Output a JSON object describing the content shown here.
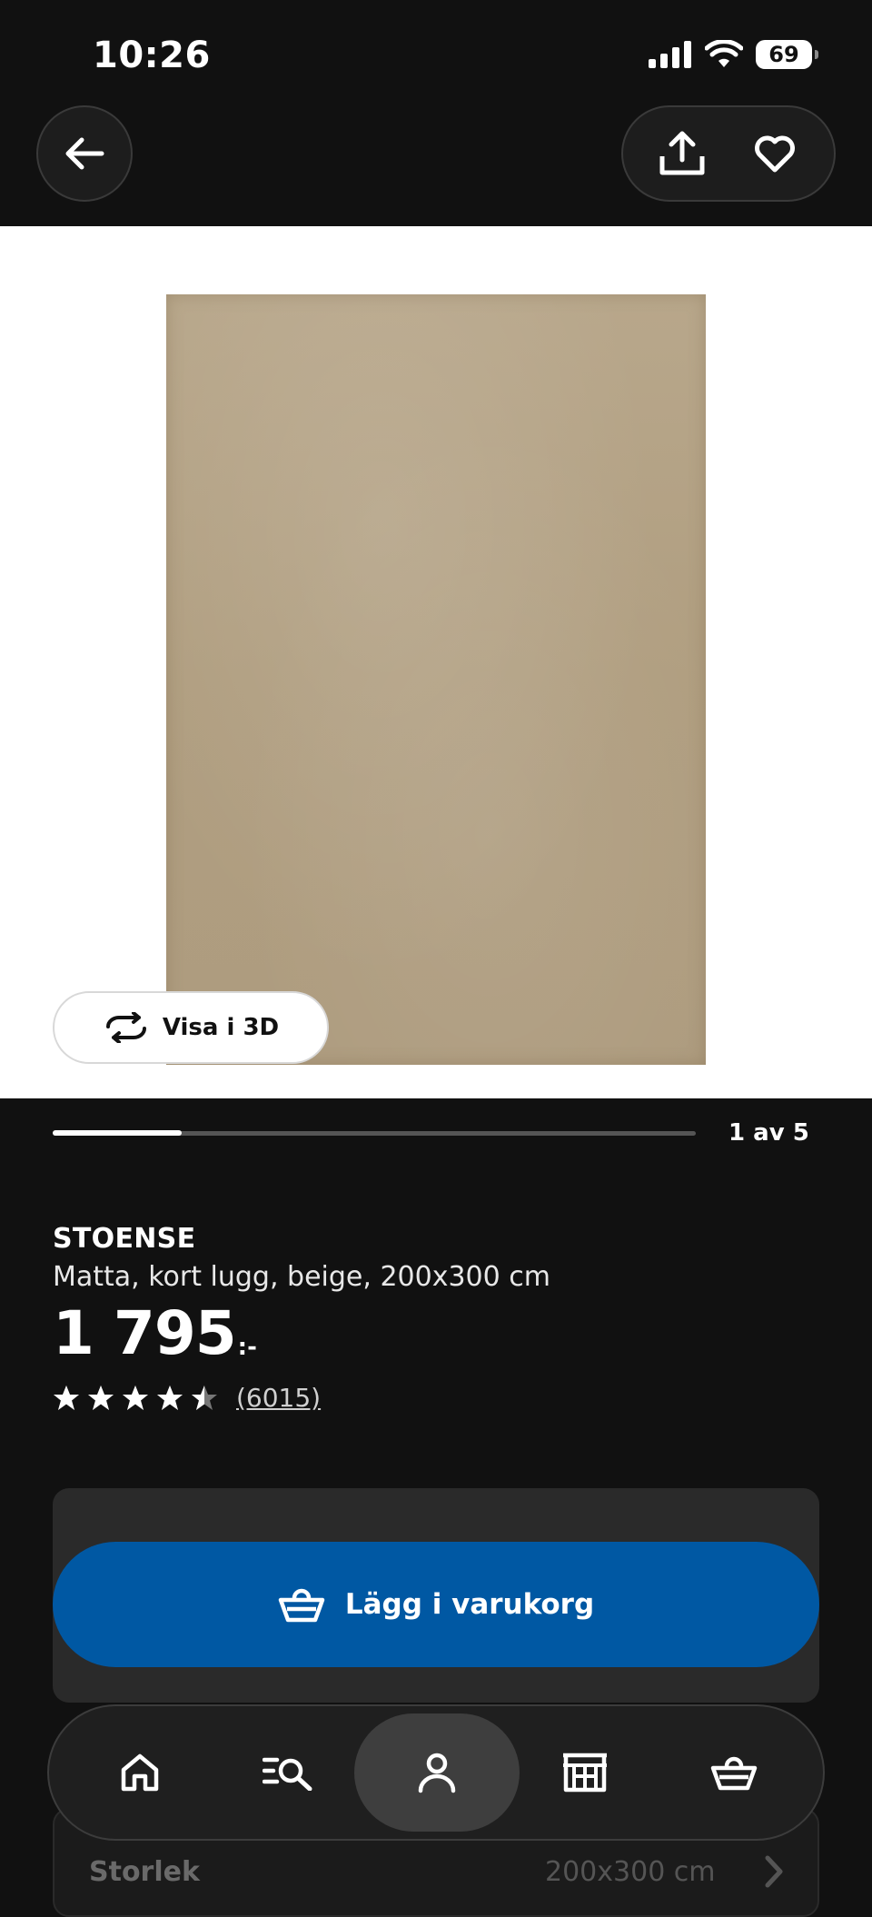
{
  "status_bar": {
    "time": "10:26",
    "battery": "69",
    "icons": [
      "signal-icon",
      "wifi-icon",
      "battery-icon"
    ]
  },
  "header": {
    "icons": [
      "back-arrow-icon",
      "share-icon",
      "heart-icon"
    ]
  },
  "gallery": {
    "view_3d_label": "Visa i 3D",
    "page_indicator": "1 av 5",
    "progress_fraction": 0.2
  },
  "product": {
    "name": "STOENSE",
    "description": "Matta, kort lugg, beige, 200x300 cm",
    "price": "1 795",
    "price_suffix": ":-",
    "rating_value": 4.5,
    "rating_max": 5,
    "review_count": "(6015)"
  },
  "cart": {
    "button_label": "Lägg i varukorg"
  },
  "size_row": {
    "label": "Storlek",
    "value": "200x300 cm"
  },
  "bottom_nav": {
    "items": [
      "home-icon",
      "search-list-icon",
      "profile-icon",
      "store-icon",
      "cart-basket-icon"
    ],
    "active": "profile-icon"
  },
  "colors": {
    "background": "#111111",
    "primary_blue": "#0058a3",
    "rug_beige": "#b09e80"
  }
}
